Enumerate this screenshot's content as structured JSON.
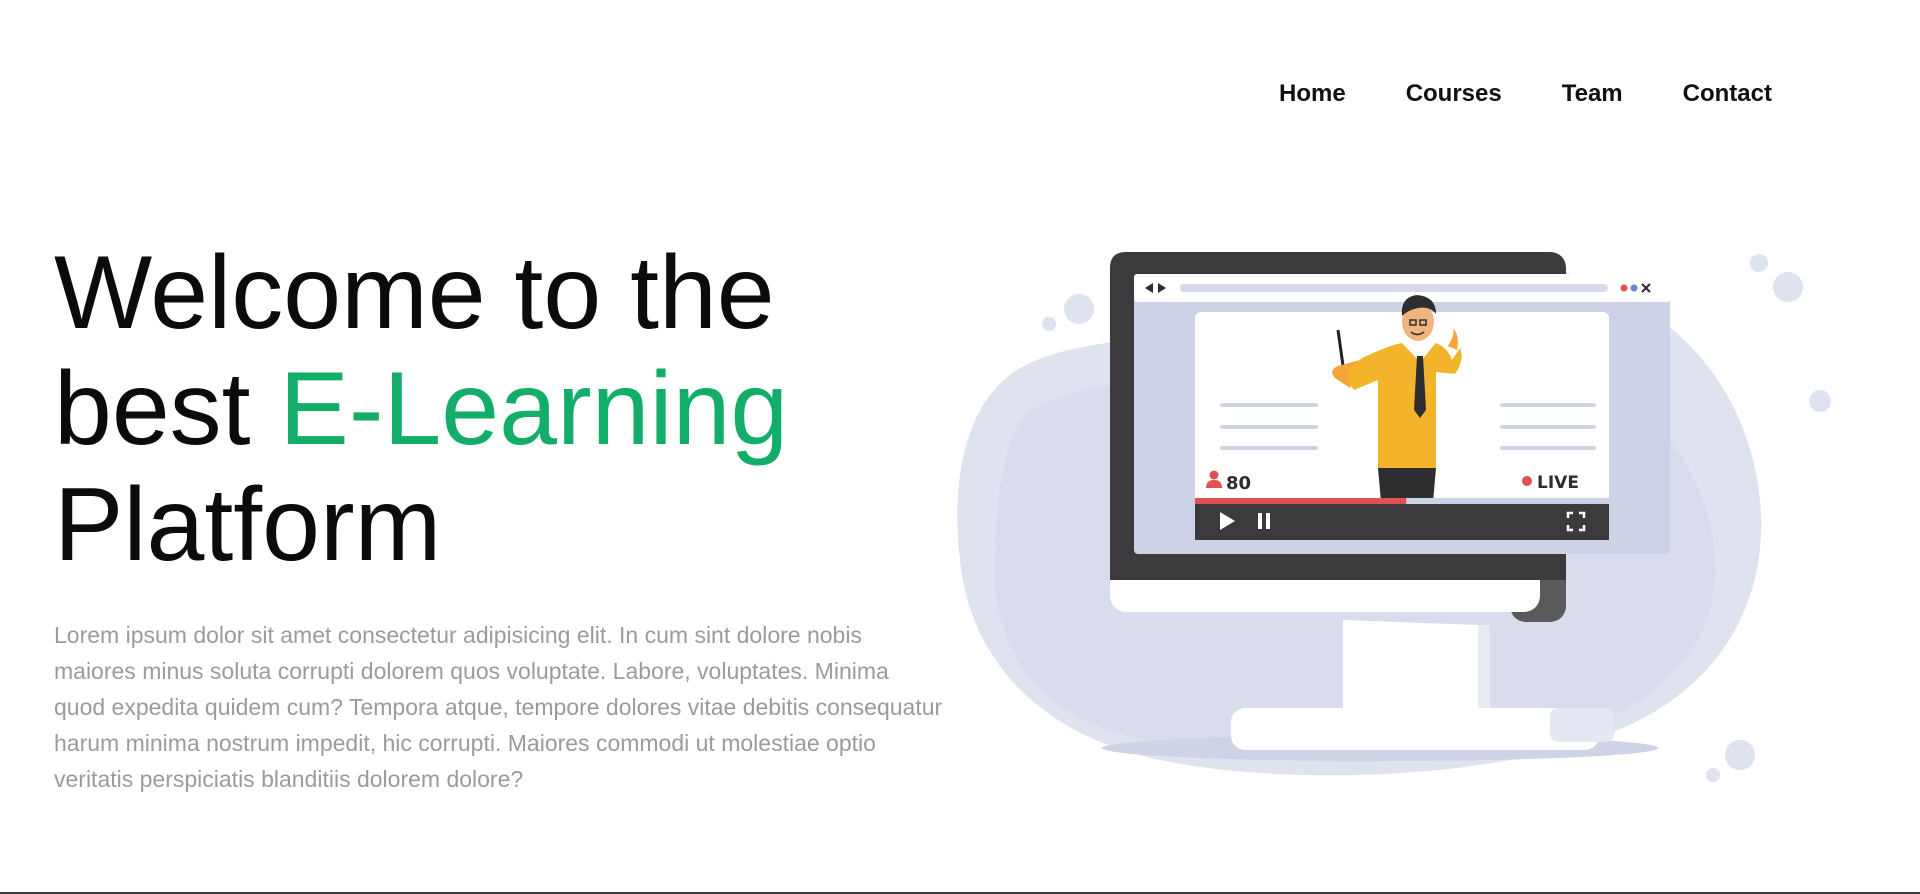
{
  "nav": {
    "items": [
      {
        "label": "Home"
      },
      {
        "label": "Courses"
      },
      {
        "label": "Team"
      },
      {
        "label": "Contact"
      }
    ]
  },
  "hero": {
    "title_line1": "Welcome to the",
    "title_line2_prefix": "best ",
    "title_line2_accent": "E-Learning",
    "title_line3": "Platform",
    "description": "Lorem ipsum dolor sit amet consectetur adipisicing elit. In cum sint dolore nobis maiores minus soluta corrupti dolorem quos voluptate. Labore, voluptates. Minima quod expedita quidem cum? Tempora atque, tempore dolores vitae debitis consequatur harum minima nostrum impedit, hic corrupti. Maiores commodi ut molestiae optio veritatis perspiciatis blanditiis dolorem dolore?"
  },
  "illustration": {
    "viewer_count": "80",
    "live_label": "LIVE",
    "video_progress": 0.51
  },
  "colors": {
    "accent": "#11ad69",
    "text_dark": "#0b0b0b",
    "text_muted": "#9b9b9b",
    "blob": "#dfe2ef",
    "monitor_frame": "#3b3b3d",
    "live_red": "#e0514f"
  }
}
